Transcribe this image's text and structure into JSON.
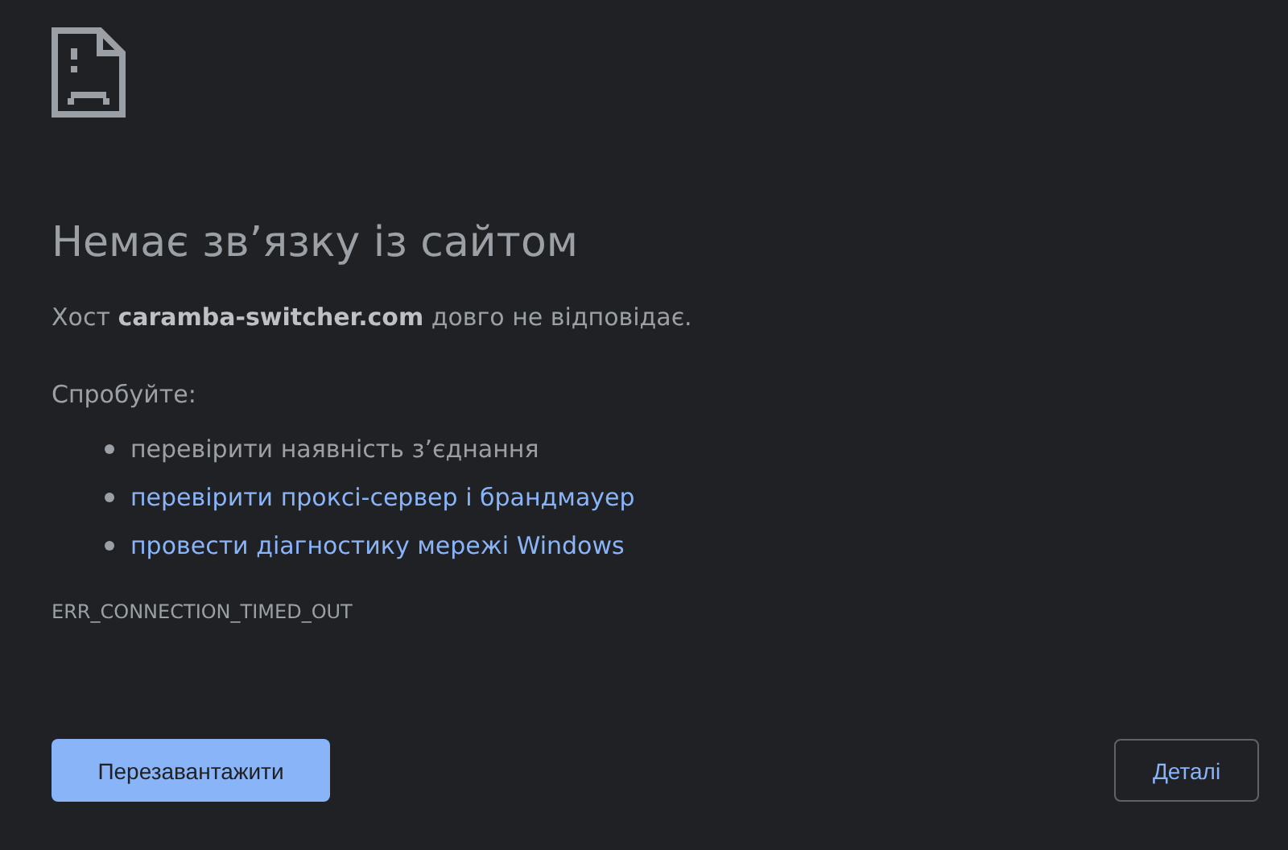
{
  "heading": "Немає зв’язку із сайтом",
  "message": "Хост **caramba-switcher.com** довго не відповідає.",
  "suggestions_intro": "Спробуйте:",
  "suggestions": [
    {
      "kind": "text",
      "text": "перевірити наявність з’єднання"
    },
    {
      "kind": "link",
      "text": "перевірити проксі-сервер і брандмауер"
    },
    {
      "kind": "link",
      "text": "провести діагностику мережі Windows"
    }
  ],
  "error_code": "ERR_CONNECTION_TIMED_OUT",
  "buttons": {
    "reload": "Перезавантажити",
    "details": "Деталі"
  }
}
